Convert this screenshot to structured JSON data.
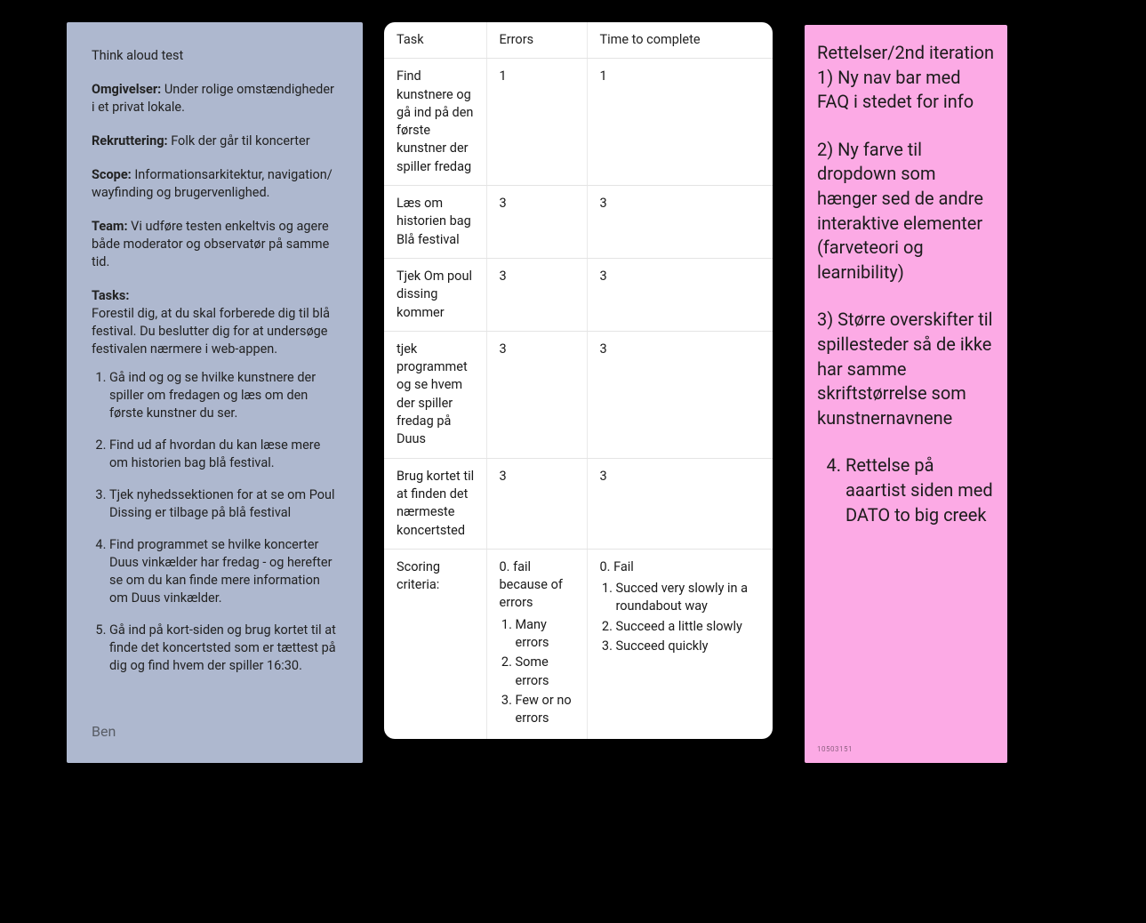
{
  "blue": {
    "title": "Think aloud test",
    "omg_label": "Omgivelser:",
    "omg_text": " Under rolige omstændigheder i et privat lokale.",
    "rek_label": "Rekruttering:",
    "rek_text": " Folk der går til koncerter",
    "scope_label": "Scope:",
    "scope_text": " Informationsarkitektur, navigation/ wayfinding og brugervenlighed.",
    "team_label": "Team:",
    "team_text": " Vi udføre testen enkeltvis og agere både moderator og observatør på samme tid.",
    "tasks_label": "Tasks:",
    "tasks_intro": "Forestil dig, at du skal forberede dig til blå festival. Du beslutter dig for at undersøge festivalen nærmere i web-appen.",
    "tasks": [
      "Gå ind og og se hvilke kunstnere der spiller om fredagen og læs om den første kunstner du ser.",
      "Find ud af hvordan du kan læse mere om historien bag blå festival.",
      "Tjek nyhedssektionen for at se om Poul Dissing er tilbage på blå festival",
      "Find programmet se hvilke koncerter Duus vinkælder har fredag - og herefter se om du kan finde mere information om Duus vinkælder.",
      "Gå ind på kort-siden og brug kortet til at finde det koncertsted som er tættest på dig og find hvem der spiller 16:30."
    ],
    "author": "Ben"
  },
  "table": {
    "headers": {
      "task": "Task",
      "errors": "Errors",
      "time": "Time to complete"
    },
    "rows": [
      {
        "task": "Find kunstnere og gå ind på den første kunstner der spiller fredag",
        "errors": "1",
        "time": "1"
      },
      {
        "task": "Læs om historien bag Blå festival",
        "errors": "3",
        "time": "3"
      },
      {
        "task": "Tjek Om poul dissing kommer",
        "errors": "3",
        "time": "3"
      },
      {
        "task": "tjek programmet og se hvem der spiller fredag på Duus",
        "errors": "3",
        "time": "3"
      },
      {
        "task": "Brug kortet til at finden det nærmeste koncertsted",
        "errors": "3",
        "time": "3"
      }
    ],
    "criteria_label": "Scoring criteria:",
    "errors_zero": "0. fail because of errors",
    "errors_items": [
      "Many errors",
      "Some errors",
      "Few or no errors"
    ],
    "time_zero": "0. Fail",
    "time_items": [
      "Succed very slowly in a roundabout way",
      "Succeed a little slowly",
      "Succeed quickly"
    ]
  },
  "pink": {
    "heading": "Rettelser/2nd iteration",
    "line1": "1) Ny nav bar med FAQ i stedet for info",
    "line2": "2) Ny farve til dropdown som hænger sed de andre interaktive elementer (farveteori og learnibility)",
    "line3": "3) Større overskifter til spillesteder så de ikke har samme skriftstørrelse som kunstnernavnene",
    "list4": "Rettelse på aaartist siden med DATO to big creek",
    "id": "10503151"
  }
}
